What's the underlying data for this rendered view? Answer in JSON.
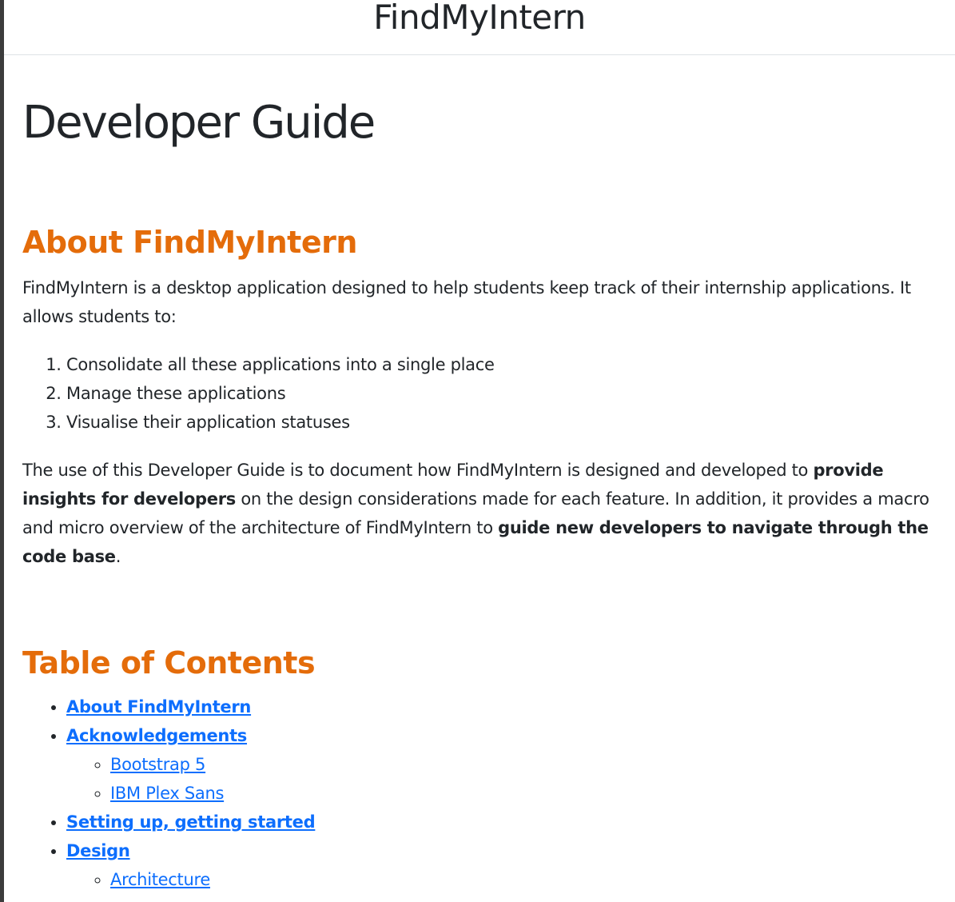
{
  "header": {
    "site_title": "FindMyIntern"
  },
  "page": {
    "title": "Developer Guide"
  },
  "about": {
    "heading": "About FindMyIntern",
    "intro": "FindMyIntern is a desktop application designed to help students keep track of their internship applications. It allows students to:",
    "list": [
      "Consolidate all these applications into a single place",
      "Manage these applications",
      "Visualise their application statuses"
    ],
    "purpose_1": "The use of this Developer Guide is to document how FindMyIntern is designed and developed to ",
    "purpose_bold_1": "provide insights for developers",
    "purpose_2": " on the design considerations made for each feature. In addition, it provides a macro and micro overview of the architecture of FindMyIntern to ",
    "purpose_bold_2": "guide new developers to navigate through the code base",
    "purpose_3": "."
  },
  "toc": {
    "heading": "Table of Contents",
    "items": [
      {
        "label": "About FindMyIntern"
      },
      {
        "label": "Acknowledgements"
      },
      {
        "label": "Bootstrap 5"
      },
      {
        "label": "IBM Plex Sans"
      },
      {
        "label": "Setting up, getting started"
      },
      {
        "label": "Design"
      },
      {
        "label": "Architecture"
      }
    ]
  }
}
